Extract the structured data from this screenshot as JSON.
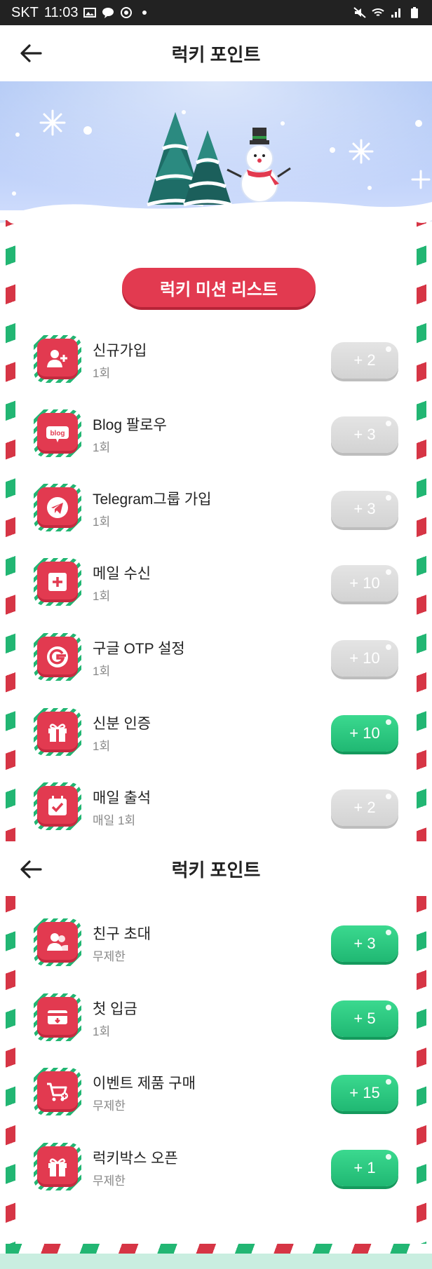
{
  "status_bar": {
    "carrier": "SKT",
    "time": "11:03"
  },
  "header": {
    "title": "럭키 포인트"
  },
  "section_title": "럭키 미션 리스트",
  "missions_top": [
    {
      "icon": "add-user-icon",
      "name": "신규가입",
      "frequency": "1회",
      "points": "+ 2",
      "state": "disabled"
    },
    {
      "icon": "blog-icon",
      "name": "Blog 팔로우",
      "frequency": "1회",
      "points": "+ 3",
      "state": "disabled"
    },
    {
      "icon": "telegram-icon",
      "name": "Telegram그룹 가입",
      "frequency": "1회",
      "points": "+ 3",
      "state": "disabled"
    },
    {
      "icon": "mail-icon",
      "name": "메일 수신",
      "frequency": "1회",
      "points": "+ 10",
      "state": "disabled"
    },
    {
      "icon": "google-icon",
      "name": "구글 OTP 설정",
      "frequency": "1회",
      "points": "+ 10",
      "state": "disabled"
    },
    {
      "icon": "gift-icon",
      "name": "신분 인증",
      "frequency": "1회",
      "points": "+ 10",
      "state": "active"
    },
    {
      "icon": "calendar-check-icon",
      "name": "매일 출석",
      "frequency": "매일 1회",
      "points": "+ 2",
      "state": "disabled"
    }
  ],
  "missions_bottom": [
    {
      "icon": "invite-friend-icon",
      "name": "친구 초대",
      "frequency": "무제한",
      "points": "+ 3",
      "state": "active"
    },
    {
      "icon": "card-deposit-icon",
      "name": "첫 입금",
      "frequency": "1회",
      "points": "+ 5",
      "state": "active"
    },
    {
      "icon": "cart-icon",
      "name": "이벤트 제품 구매",
      "frequency": "무제한",
      "points": "+ 15",
      "state": "active"
    },
    {
      "icon": "gift-icon",
      "name": "럭키박스 오픈",
      "frequency": "무제한",
      "points": "+ 1",
      "state": "active"
    }
  ],
  "colors": {
    "accent_red": "#e23a50",
    "accent_green": "#22b673",
    "disabled_grey": "#d3d3d3"
  }
}
